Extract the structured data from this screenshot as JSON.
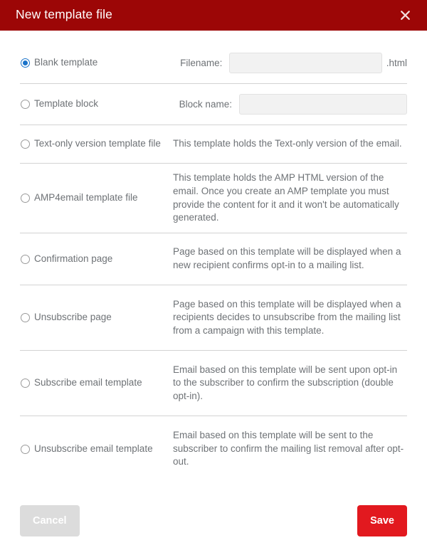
{
  "dialog": {
    "title": "New template file",
    "close_icon": "close-icon"
  },
  "options": [
    {
      "id": "blank-template",
      "label": "Blank template",
      "selected": true,
      "field_label": "Filename:",
      "field_value": "",
      "field_placeholder": "",
      "suffix": ".html",
      "description": ""
    },
    {
      "id": "template-block",
      "label": "Template block",
      "selected": false,
      "field_label": "Block name:",
      "field_value": "",
      "field_placeholder": "",
      "suffix": "",
      "description": ""
    },
    {
      "id": "text-only-version-template-file",
      "label": "Text-only version template file",
      "selected": false,
      "description": "This template holds the Text-only version of the email."
    },
    {
      "id": "amp4email-template-file",
      "label": "AMP4email template file",
      "selected": false,
      "description": "This template holds the AMP HTML version of the email. Once you create an AMP template you must provide the content for it and it won't be automatically generated."
    },
    {
      "id": "confirmation-page",
      "label": "Confirmation page",
      "selected": false,
      "description": "Page based on this template will be displayed when a new recipient confirms opt-in to a mailing list."
    },
    {
      "id": "unsubscribe-page",
      "label": "Unsubscribe page",
      "selected": false,
      "description": "Page based on this template will be displayed when a recipients decides to unsubscribe from the mailing list from a campaign with this template."
    },
    {
      "id": "subscribe-email-template",
      "label": "Subscribe email template",
      "selected": false,
      "description": "Email based on this template will be sent upon opt-in to the subscriber to confirm the subscription (double opt-in)."
    },
    {
      "id": "unsubscribe-email-template",
      "label": "Unsubscribe email template",
      "selected": false,
      "description": "Email based on this template will be sent to the subscriber to confirm the mailing list removal after opt-out."
    }
  ],
  "footer": {
    "cancel_label": "Cancel",
    "save_label": "Save"
  },
  "colors": {
    "header_red": "#9c0606",
    "save_red": "#e2191f",
    "cancel_gray": "#dcdcdc",
    "radio_blue": "#1a73c9",
    "text_gray": "#6e7276",
    "divider": "#d3d3d3",
    "input_bg": "#f2f2f2"
  }
}
